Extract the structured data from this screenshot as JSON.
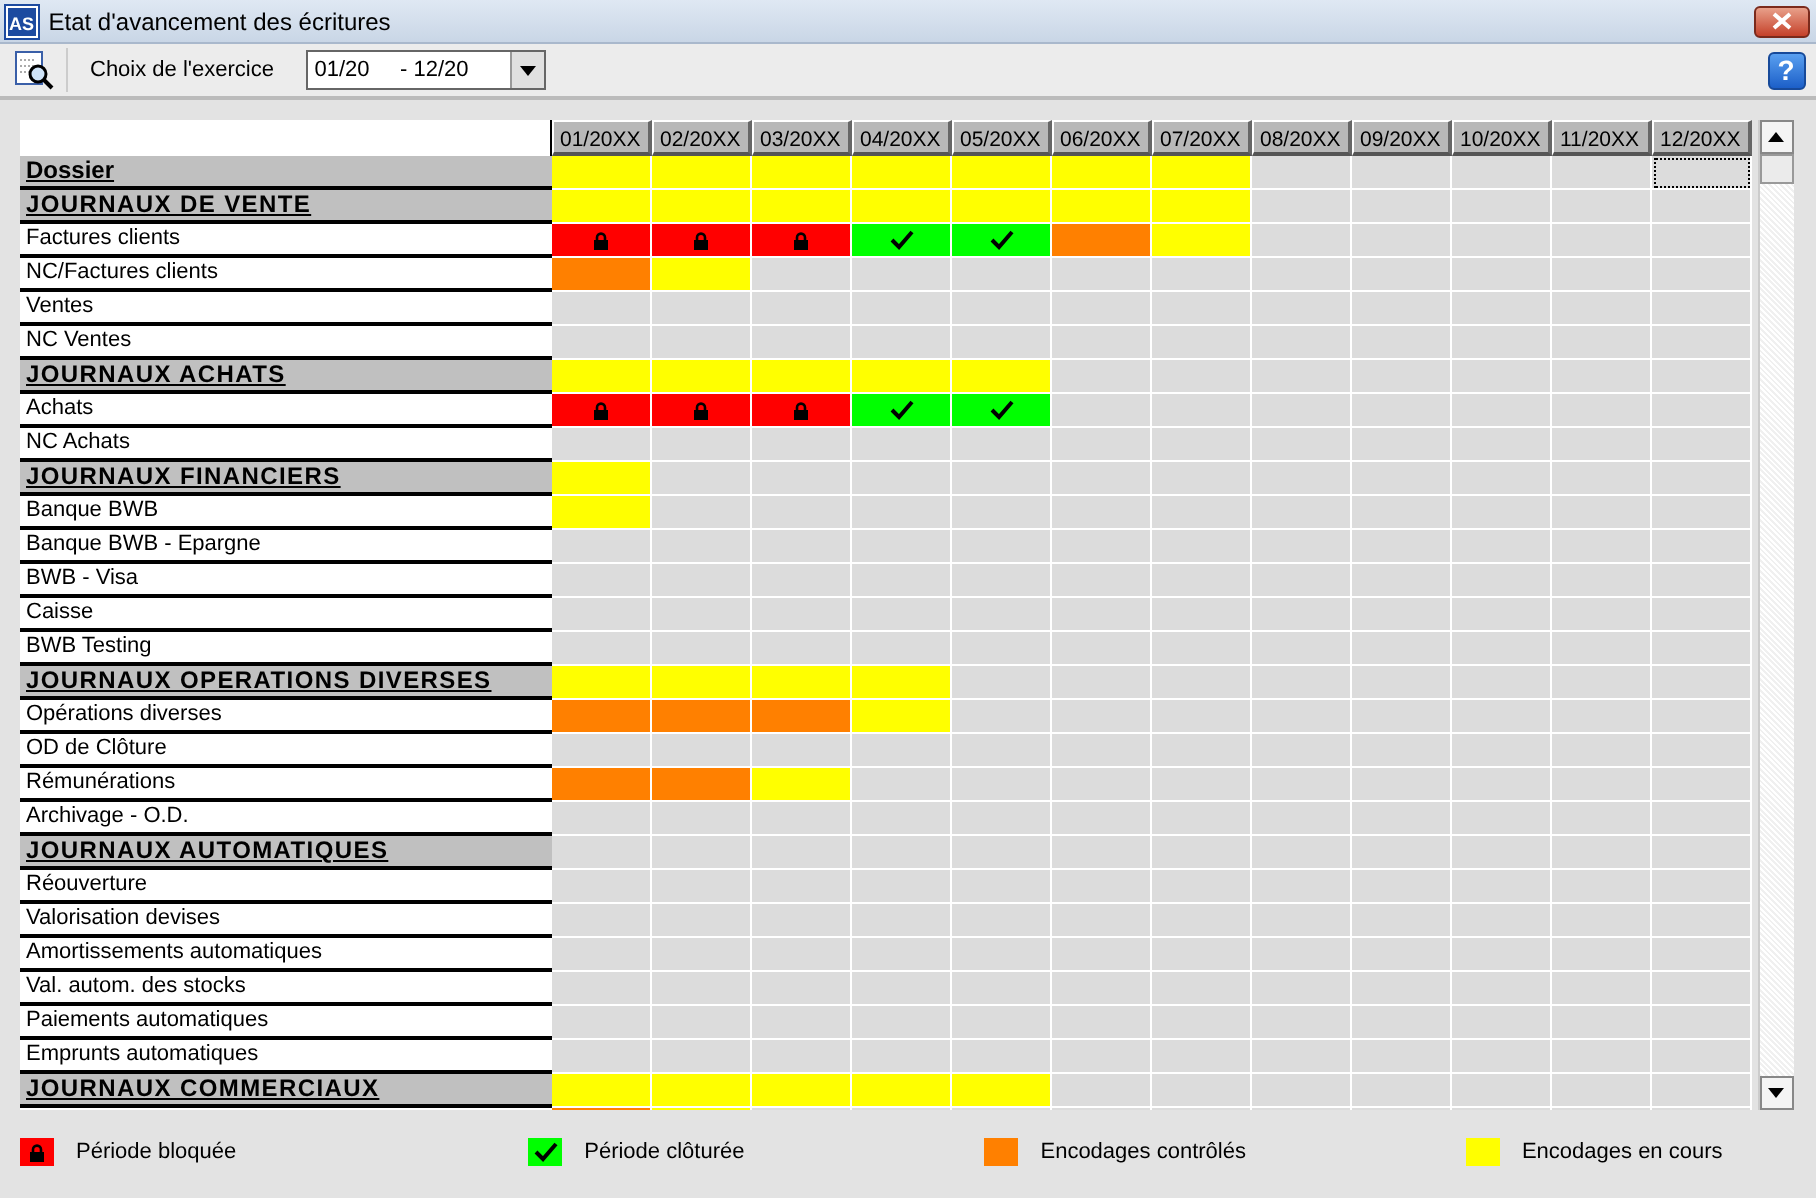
{
  "window": {
    "app_icon": "AS",
    "title": "Etat d'avancement des écritures"
  },
  "toolbar": {
    "label": "Choix de l'exercice",
    "period": "01/20     - 12/20",
    "help": "?"
  },
  "table": {
    "months": [
      "01/20XX",
      "02/20XX",
      "03/20XX",
      "04/20XX",
      "05/20XX",
      "06/20XX",
      "07/20XX",
      "08/20XX",
      "09/20XX",
      "10/20XX",
      "11/20XX",
      "12/20XX"
    ],
    "rows": [
      {
        "kind": "dossier",
        "label": "Dossier",
        "cells": [
          {
            "kind": "in_progress"
          },
          {
            "kind": "in_progress"
          },
          {
            "kind": "in_progress"
          },
          {
            "kind": "in_progress"
          },
          {
            "kind": "in_progress"
          },
          {
            "kind": "in_progress"
          },
          {
            "kind": "in_progress"
          },
          {
            "kind": "empty"
          },
          {
            "kind": "empty"
          },
          {
            "kind": "empty"
          },
          {
            "kind": "empty"
          },
          {
            "kind": "empty",
            "focused": true
          }
        ]
      },
      {
        "kind": "section",
        "label": "JOURNAUX DE VENTE",
        "cells": [
          {
            "kind": "in_progress"
          },
          {
            "kind": "in_progress"
          },
          {
            "kind": "in_progress"
          },
          {
            "kind": "in_progress"
          },
          {
            "kind": "in_progress"
          },
          {
            "kind": "in_progress"
          },
          {
            "kind": "in_progress"
          }
        ]
      },
      {
        "kind": "item",
        "label": "Factures clients",
        "cells": [
          {
            "kind": "locked"
          },
          {
            "kind": "locked"
          },
          {
            "kind": "locked"
          },
          {
            "kind": "closed"
          },
          {
            "kind": "closed"
          },
          {
            "kind": "checked"
          },
          {
            "kind": "in_progress"
          }
        ]
      },
      {
        "kind": "item",
        "label": "NC/Factures clients",
        "cells": [
          {
            "kind": "checked"
          },
          {
            "kind": "in_progress"
          }
        ]
      },
      {
        "kind": "item",
        "label": "Ventes"
      },
      {
        "kind": "item",
        "label": "NC Ventes"
      },
      {
        "kind": "section",
        "label": "JOURNAUX ACHATS",
        "cells": [
          {
            "kind": "in_progress"
          },
          {
            "kind": "in_progress"
          },
          {
            "kind": "in_progress"
          },
          {
            "kind": "in_progress"
          },
          {
            "kind": "in_progress"
          }
        ]
      },
      {
        "kind": "item",
        "label": "Achats",
        "cells": [
          {
            "kind": "locked"
          },
          {
            "kind": "locked"
          },
          {
            "kind": "locked"
          },
          {
            "kind": "closed"
          },
          {
            "kind": "closed"
          }
        ]
      },
      {
        "kind": "item",
        "label": "NC Achats"
      },
      {
        "kind": "section",
        "label": "JOURNAUX FINANCIERS",
        "cells": [
          {
            "kind": "in_progress"
          }
        ]
      },
      {
        "kind": "item",
        "label": "Banque BWB",
        "cells": [
          {
            "kind": "in_progress"
          }
        ]
      },
      {
        "kind": "item",
        "label": "Banque BWB - Epargne"
      },
      {
        "kind": "item",
        "label": "BWB - Visa"
      },
      {
        "kind": "item",
        "label": "Caisse"
      },
      {
        "kind": "item",
        "label": "BWB Testing"
      },
      {
        "kind": "section",
        "label": "JOURNAUX OPERATIONS DIVERSES",
        "cells": [
          {
            "kind": "in_progress"
          },
          {
            "kind": "in_progress"
          },
          {
            "kind": "in_progress"
          },
          {
            "kind": "in_progress"
          }
        ]
      },
      {
        "kind": "item",
        "label": "Opérations diverses",
        "cells": [
          {
            "kind": "checked"
          },
          {
            "kind": "checked"
          },
          {
            "kind": "checked"
          },
          {
            "kind": "in_progress"
          }
        ]
      },
      {
        "kind": "item",
        "label": "OD de Clôture"
      },
      {
        "kind": "item",
        "label": "Rémunérations",
        "cells": [
          {
            "kind": "checked"
          },
          {
            "kind": "checked"
          },
          {
            "kind": "in_progress"
          }
        ]
      },
      {
        "kind": "item",
        "label": "Archivage - O.D."
      },
      {
        "kind": "section",
        "label": "JOURNAUX AUTOMATIQUES"
      },
      {
        "kind": "item",
        "label": "Réouverture"
      },
      {
        "kind": "item",
        "label": "Valorisation devises"
      },
      {
        "kind": "item",
        "label": "Amortissements automatiques"
      },
      {
        "kind": "item",
        "label": "Val. autom. des stocks"
      },
      {
        "kind": "item",
        "label": "Paiements automatiques"
      },
      {
        "kind": "item",
        "label": "Emprunts automatiques"
      },
      {
        "kind": "section",
        "label": "JOURNAUX COMMERCIAUX",
        "cells": [
          {
            "kind": "in_progress"
          },
          {
            "kind": "in_progress"
          },
          {
            "kind": "in_progress"
          },
          {
            "kind": "in_progress"
          },
          {
            "kind": "in_progress"
          }
        ]
      },
      {
        "kind": "item",
        "cells": [
          {
            "kind": "checked"
          },
          {
            "kind": "in_progress"
          }
        ]
      }
    ]
  },
  "legend": [
    {
      "kind": "locked",
      "label": "Période bloquée"
    },
    {
      "kind": "closed",
      "label": "Période clôturée"
    },
    {
      "kind": "checked",
      "label": "Encodages contrôlés"
    },
    {
      "kind": "in_progress",
      "label": "Encodages en cours"
    }
  ]
}
